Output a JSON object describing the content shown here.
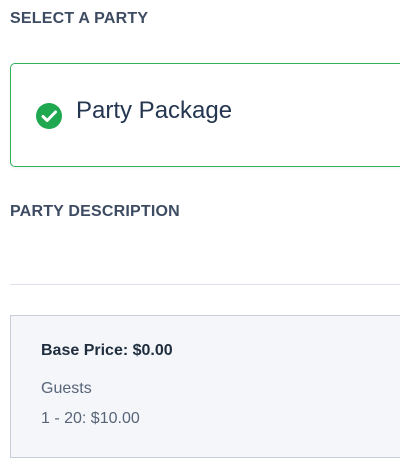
{
  "select_section": {
    "heading": "SELECT A PARTY"
  },
  "party_option": {
    "name": "Party Package",
    "selected": true,
    "icon": "check-circle-icon",
    "accent_color": "#2fb35a"
  },
  "description_section": {
    "heading": "PARTY DESCRIPTION"
  },
  "pricing": {
    "base_price": "Base Price: $0.00",
    "guests_label": "Guests",
    "guests_tiers": [
      {
        "label": "1 - 20: $10.00"
      }
    ]
  }
}
